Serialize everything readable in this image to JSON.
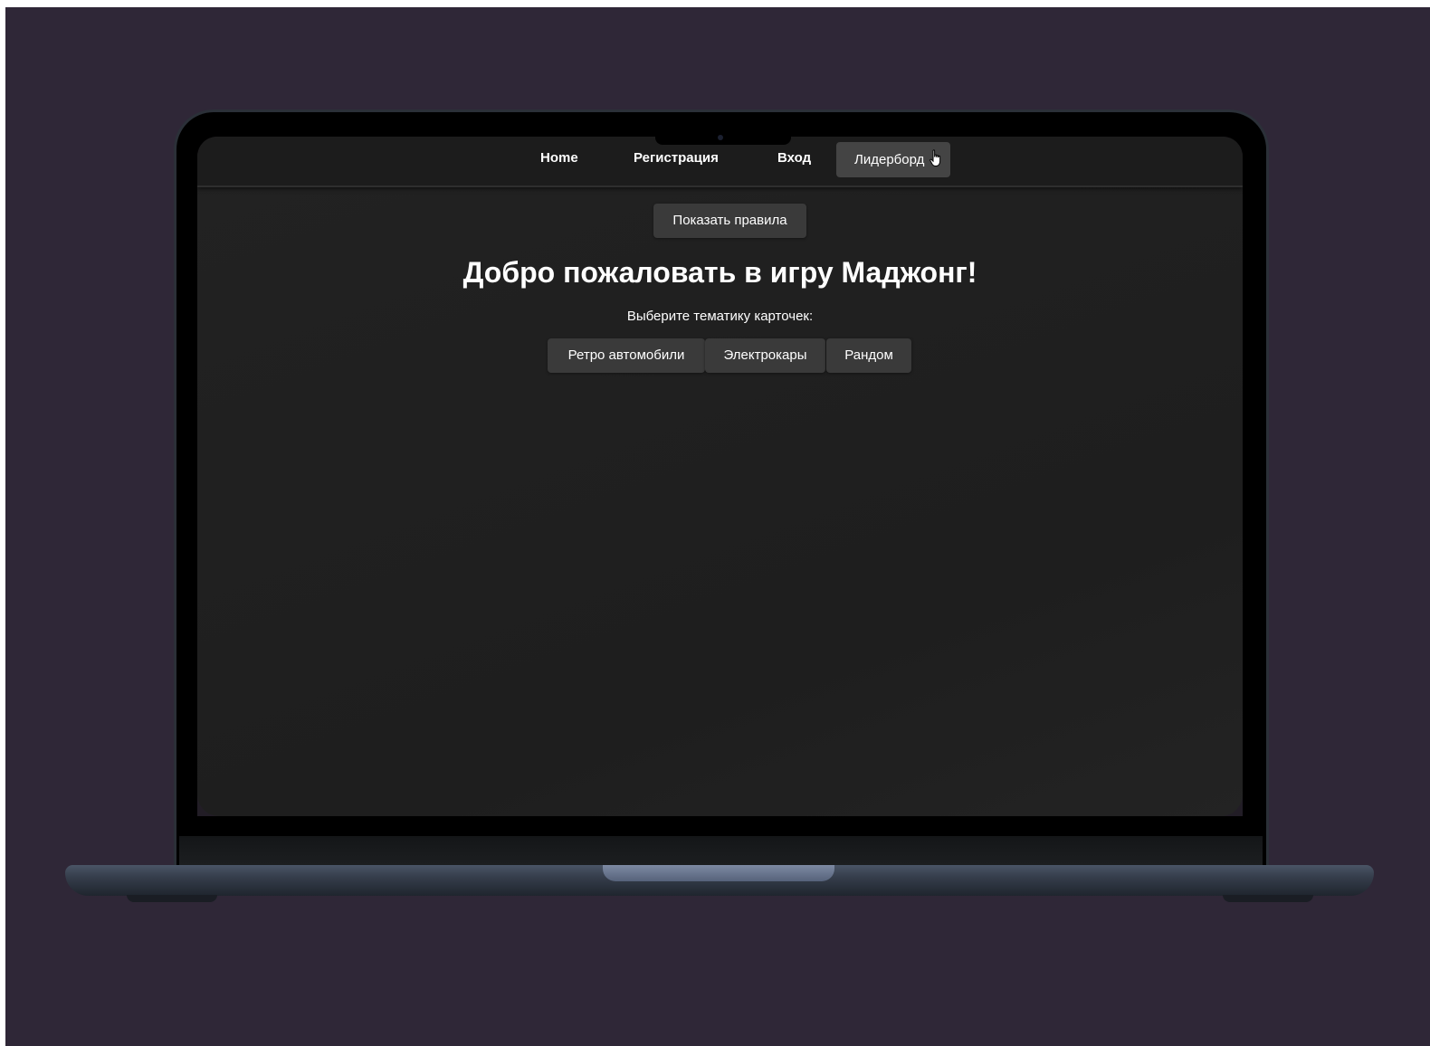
{
  "navbar": {
    "links": [
      {
        "label": "Home"
      },
      {
        "label": "Регистрация"
      },
      {
        "label": "Вход"
      },
      {
        "label": "Лидерборд"
      }
    ]
  },
  "main": {
    "rules_button_label": "Показать правила",
    "title": "Добро пожаловать в игру Маджонг!",
    "theme_prompt": "Выберите тематику карточек:",
    "themes": [
      {
        "label": "Ретро автомобили"
      },
      {
        "label": "Электрокары"
      },
      {
        "label": "Рандом"
      }
    ]
  },
  "colors": {
    "page_background": "#2f2737",
    "app_background": "#1e1e1e",
    "button_background": "#3a3a3a",
    "active_nav_background": "#444444",
    "text": "#ffffff"
  },
  "icons": {
    "cursor": "hand-pointer-cursor-icon"
  }
}
